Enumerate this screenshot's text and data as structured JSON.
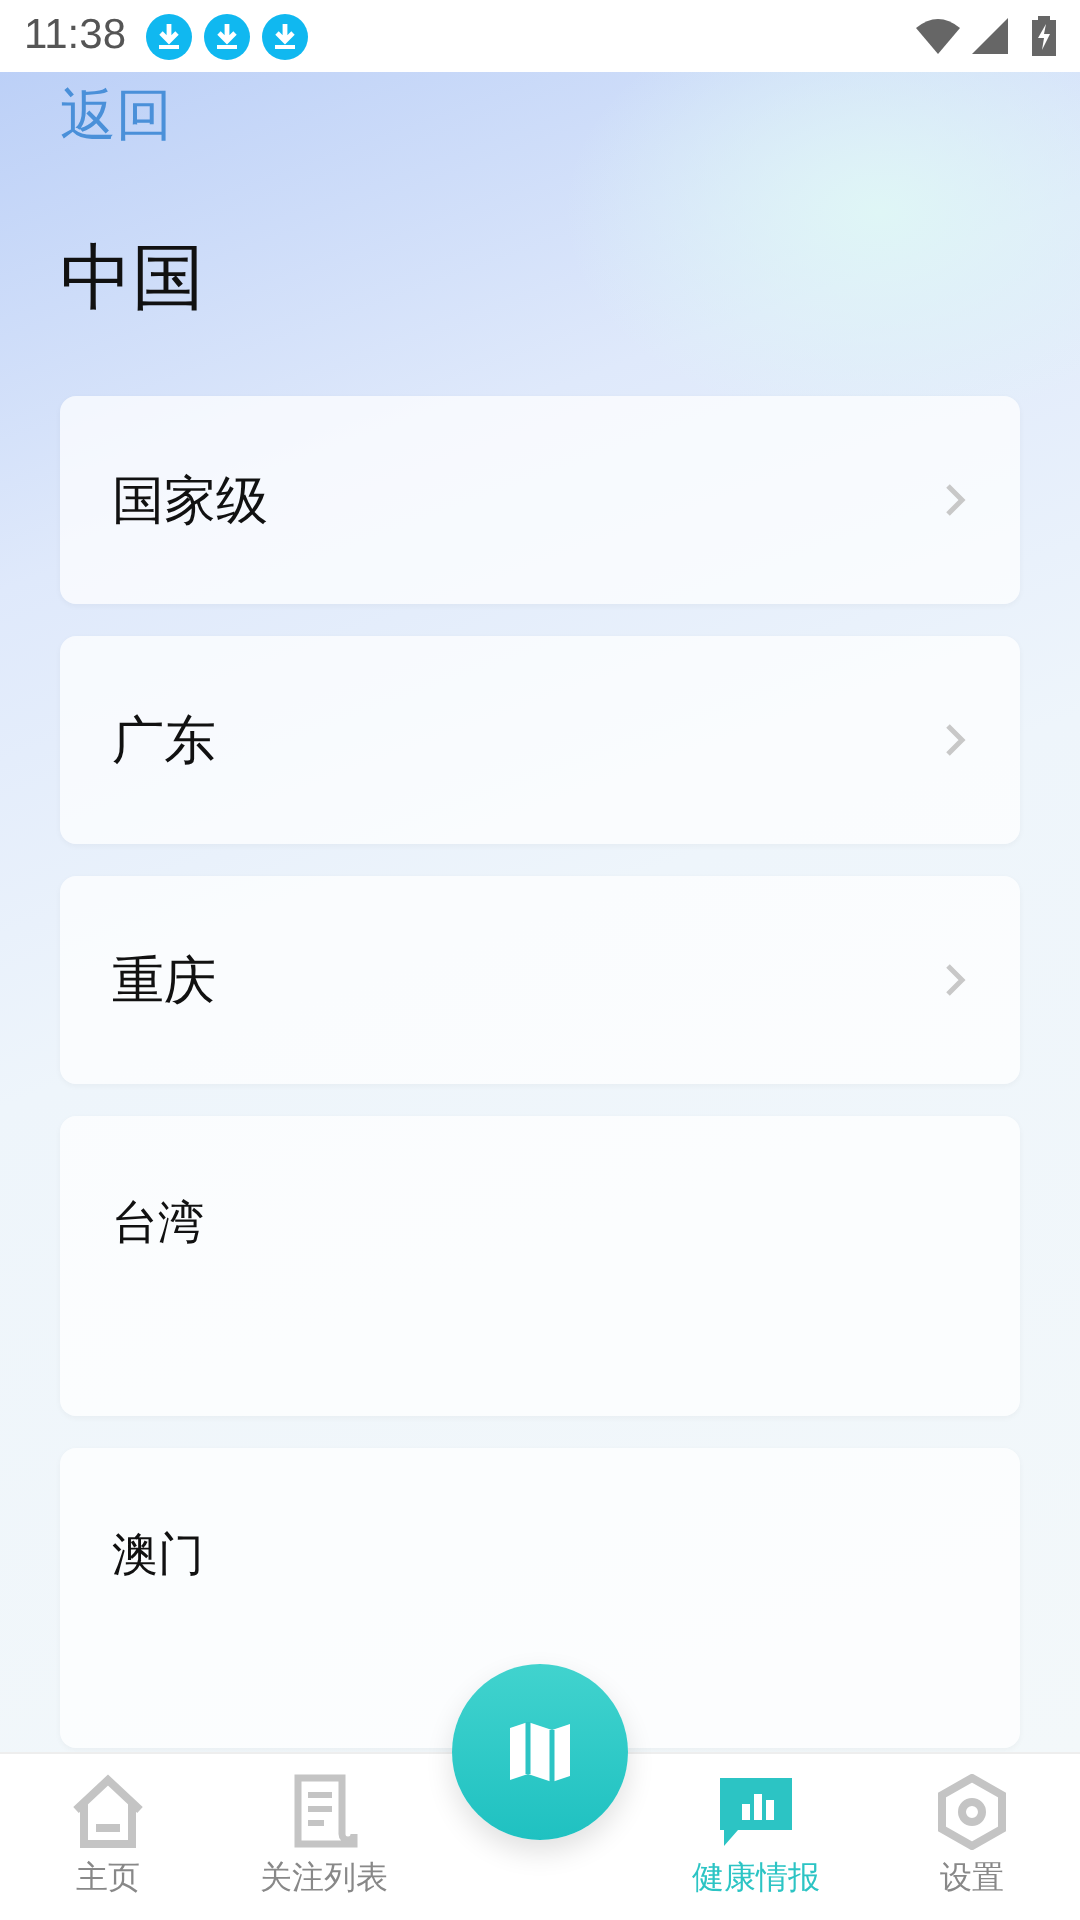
{
  "status_bar": {
    "time": "11:38",
    "notifications": [
      {
        "kind": "download"
      },
      {
        "kind": "download"
      },
      {
        "kind": "download"
      }
    ]
  },
  "header": {
    "back": "返回",
    "title": "中国"
  },
  "regions": [
    {
      "name": "国家级",
      "kind": "nav"
    },
    {
      "name": "广东",
      "kind": "nav"
    },
    {
      "name": "重庆",
      "kind": "nav"
    },
    {
      "name": "台湾",
      "kind": "static"
    },
    {
      "name": "澳门",
      "kind": "static"
    }
  ],
  "tab_bar": [
    {
      "label": "主页",
      "kind": "home",
      "selected": false
    },
    {
      "label": "关注列表",
      "kind": "list",
      "selected": false
    },
    {
      "label": "健康情报",
      "kind": "chart",
      "selected": true
    },
    {
      "label": "设置",
      "kind": "settings",
      "selected": false
    }
  ]
}
